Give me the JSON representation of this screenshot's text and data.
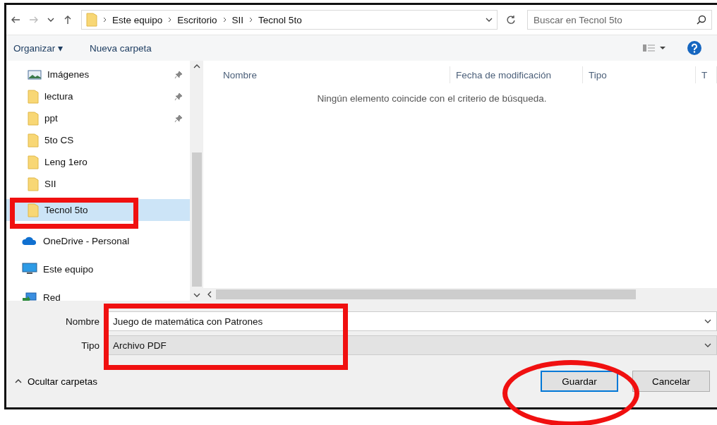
{
  "navigation": {
    "breadcrumb": [
      "Este equipo",
      "Escritorio",
      "SII",
      "Tecnol 5to"
    ],
    "search": {
      "placeholder": "Buscar en Tecnol 5to"
    }
  },
  "toolbar": {
    "items": [
      "Organizar ▾",
      "Nueva carpeta"
    ]
  },
  "sidebar": {
    "items": [
      {
        "label": "Imágenes",
        "kind": "pictures",
        "pinned": true,
        "selected": false
      },
      {
        "label": "lectura",
        "kind": "folder",
        "pinned": true,
        "selected": false
      },
      {
        "label": "ppt",
        "kind": "folder",
        "pinned": true,
        "selected": false
      },
      {
        "label": "5to CS",
        "kind": "folder",
        "pinned": false,
        "selected": false
      },
      {
        "label": "Leng 1ero",
        "kind": "folder",
        "pinned": false,
        "selected": false
      },
      {
        "label": "SII",
        "kind": "folder",
        "pinned": false,
        "selected": false
      },
      {
        "label": "Tecnol 5to",
        "kind": "folder",
        "pinned": false,
        "selected": true
      },
      {
        "label": "OneDrive - Personal",
        "kind": "cloud",
        "pinned": false,
        "selected": false
      },
      {
        "label": "Este equipo",
        "kind": "computer",
        "pinned": false,
        "selected": false
      },
      {
        "label": "Red",
        "kind": "network",
        "pinned": false,
        "selected": false
      }
    ]
  },
  "table": {
    "columns": [
      "Nombre",
      "Fecha de modificación",
      "Tipo",
      "T"
    ],
    "empty_message": "Ningún elemento coincide con el criterio de búsqueda."
  },
  "form": {
    "fields": [
      {
        "label": "Nombre",
        "value": "Juego de matemática con Patrones",
        "editable": true
      },
      {
        "label": "Tipo",
        "value": "Archivo PDF",
        "editable": false
      }
    ]
  },
  "footer": {
    "toggle": "Ocultar carpetas",
    "buttons": [
      {
        "label": "Guardar",
        "default": true
      },
      {
        "label": "Cancelar",
        "default": false
      }
    ]
  }
}
